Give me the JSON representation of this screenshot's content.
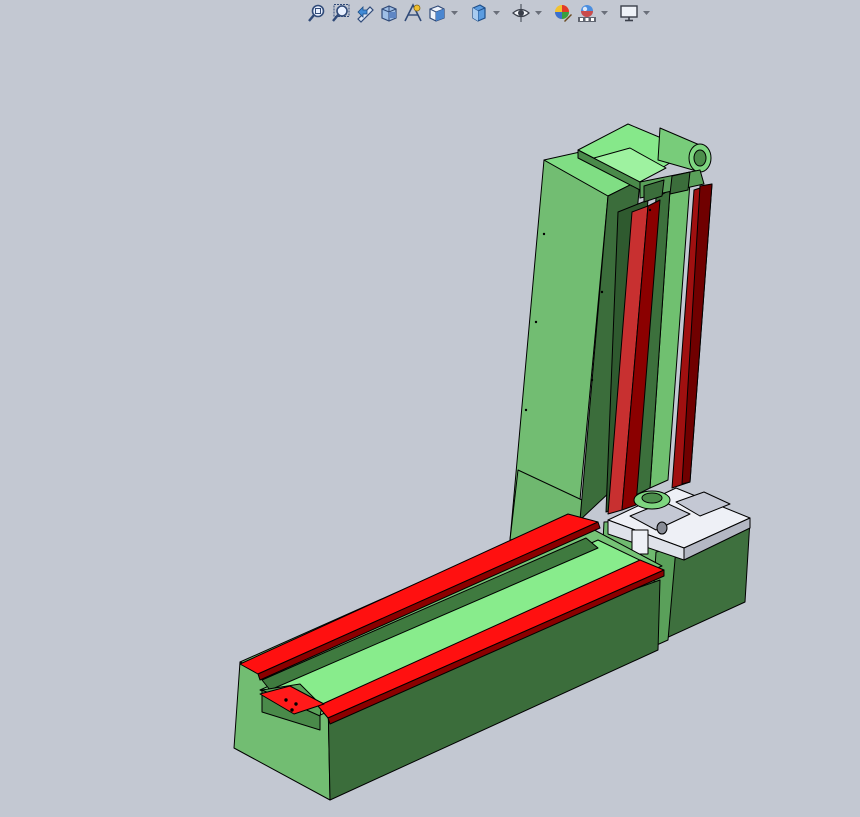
{
  "app": {
    "name": "3D CAD viewport",
    "background_color": "#c3c8d2"
  },
  "heads_up_toolbar": {
    "tools": [
      {
        "id": "zoom-to-fit",
        "icon": "zoom-to-fit-icon",
        "has_dropdown": false
      },
      {
        "id": "zoom-to-area",
        "icon": "zoom-to-area-icon",
        "has_dropdown": false
      },
      {
        "id": "previous-view",
        "icon": "previous-view-icon",
        "has_dropdown": false
      },
      {
        "id": "section-view",
        "icon": "section-view-icon",
        "has_dropdown": false
      },
      {
        "id": "dynamic-annotation-views",
        "icon": "dynamic-annotation-icon",
        "has_dropdown": false
      },
      {
        "id": "view-orientation",
        "icon": "view-orientation-icon",
        "has_dropdown": true
      },
      {
        "id": "display-style",
        "icon": "display-style-icon",
        "has_dropdown": true
      },
      {
        "id": "hide-show-items",
        "icon": "hide-show-eye-icon",
        "has_dropdown": true
      },
      {
        "id": "edit-appearance",
        "icon": "edit-appearance-icon",
        "has_dropdown": false
      },
      {
        "id": "apply-scene",
        "icon": "apply-scene-icon",
        "has_dropdown": true
      },
      {
        "id": "view-settings",
        "icon": "monitor-icon",
        "has_dropdown": true
      }
    ]
  },
  "model": {
    "description_colors": {
      "body_light": "#7fd982",
      "body_mid": "#6fbf6f",
      "body_dark": "#3a6b3a",
      "rail_red": "#ff0000",
      "rail_dark_red": "#8b0000",
      "rail_mid_red": "#b02020",
      "bracket_white": "#eef0f6"
    }
  }
}
